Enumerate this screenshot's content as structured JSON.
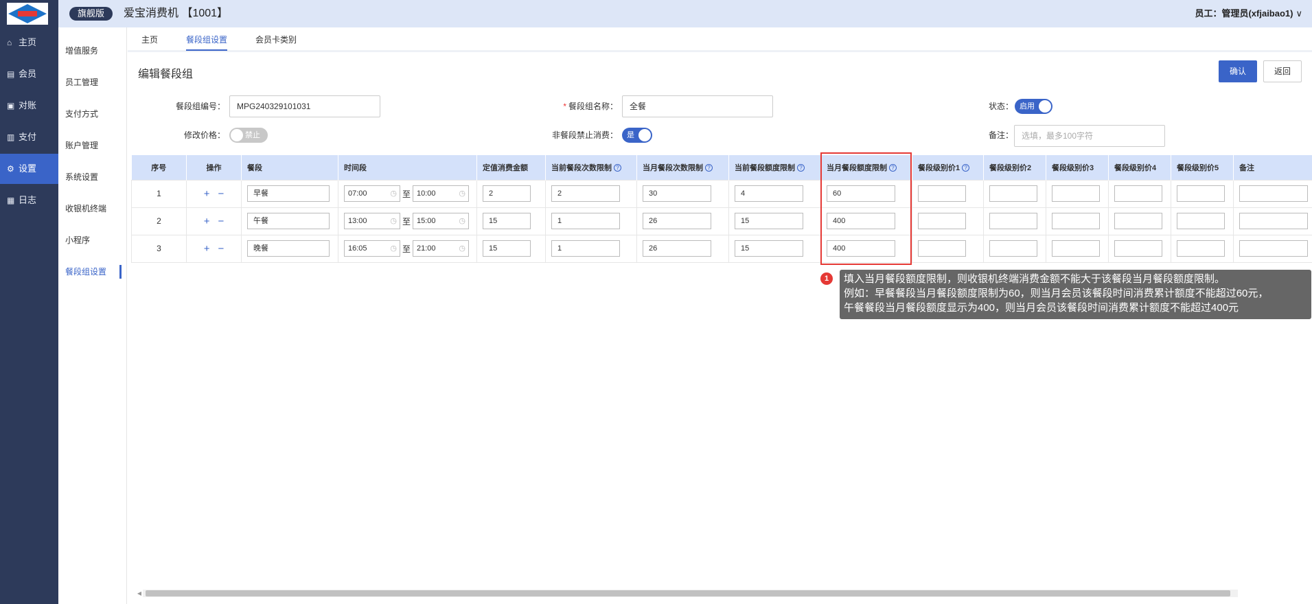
{
  "header": {
    "edition": "旗舰版",
    "app_title": "爱宝消费机 【1001】",
    "user": "员工：管理员(xfjaibao1)"
  },
  "sidebar": {
    "items": [
      {
        "label": "主页",
        "icon": "home-icon"
      },
      {
        "label": "会员",
        "icon": "member-icon"
      },
      {
        "label": "对账",
        "icon": "reconcile-icon"
      },
      {
        "label": "支付",
        "icon": "payment-icon"
      },
      {
        "label": "设置",
        "icon": "gear-icon",
        "active": true
      },
      {
        "label": "日志",
        "icon": "log-icon"
      }
    ]
  },
  "subnav": {
    "items": [
      "增值服务",
      "员工管理",
      "支付方式",
      "账户管理",
      "系统设置",
      "收银机终端",
      "小程序",
      "餐段组设置"
    ],
    "active": "餐段组设置"
  },
  "tabs": [
    {
      "label": "主页",
      "active": false
    },
    {
      "label": "餐段组设置",
      "active": true
    },
    {
      "label": "会员卡类别",
      "active": false
    }
  ],
  "page": {
    "title": "编辑餐段组",
    "confirm_label": "确认",
    "back_label": "返回"
  },
  "form": {
    "group_no_label": "餐段组编号：",
    "group_no_value": "MPG240329101031",
    "group_name_label": "餐段组名称：",
    "group_name_value": "全餐",
    "status_label": "状态：",
    "status_value": "启用",
    "modify_price_label": "修改价格：",
    "modify_price_value": "禁止",
    "forbid_label": "非餐段禁止消费：",
    "forbid_value": "是",
    "remark_label": "备注：",
    "remark_placeholder": "选填，最多100字符"
  },
  "table": {
    "headers": [
      "序号",
      "操作",
      "餐段",
      "时间段",
      "定值消费金额",
      "当前餐段次数限制",
      "当月餐段次数限制",
      "当前餐段额度限制",
      "当月餐段额度限制",
      "餐段级别价1",
      "餐段级别价2",
      "餐段级别价3",
      "餐段级别价4",
      "餐段级别价5",
      "备注"
    ],
    "to_label": "至",
    "rows": [
      {
        "no": "1",
        "name": "早餐",
        "start": "07:00",
        "end": "10:00",
        "fixed": "2",
        "cur_count": "2",
        "month_count": "30",
        "cur_amount": "4",
        "month_amount": "60"
      },
      {
        "no": "2",
        "name": "午餐",
        "start": "13:00",
        "end": "15:00",
        "fixed": "15",
        "cur_count": "1",
        "month_count": "26",
        "cur_amount": "15",
        "month_amount": "400"
      },
      {
        "no": "3",
        "name": "晚餐",
        "start": "16:05",
        "end": "21:00",
        "fixed": "15",
        "cur_count": "1",
        "month_count": "26",
        "cur_amount": "15",
        "month_amount": "400"
      }
    ]
  },
  "annotation": {
    "badge": "1",
    "lines": [
      "填入当月餐段额度限制，则收银机终端消费金额不能大于该餐段当月餐段额度限制。",
      "例如：早餐餐段当月餐段额度限制为60，则当月会员该餐段时间消费累计额度不能超过60元，",
      "午餐餐段当月餐段额度显示为400，则当月会员该餐段时间消费累计额度不能超过400元"
    ]
  },
  "colors": {
    "primary": "#3a64c8",
    "sidebar": "#2d3a5a",
    "header_bg": "#dde6f7",
    "table_header": "#d4e1fa",
    "highlight": "#e53935"
  }
}
